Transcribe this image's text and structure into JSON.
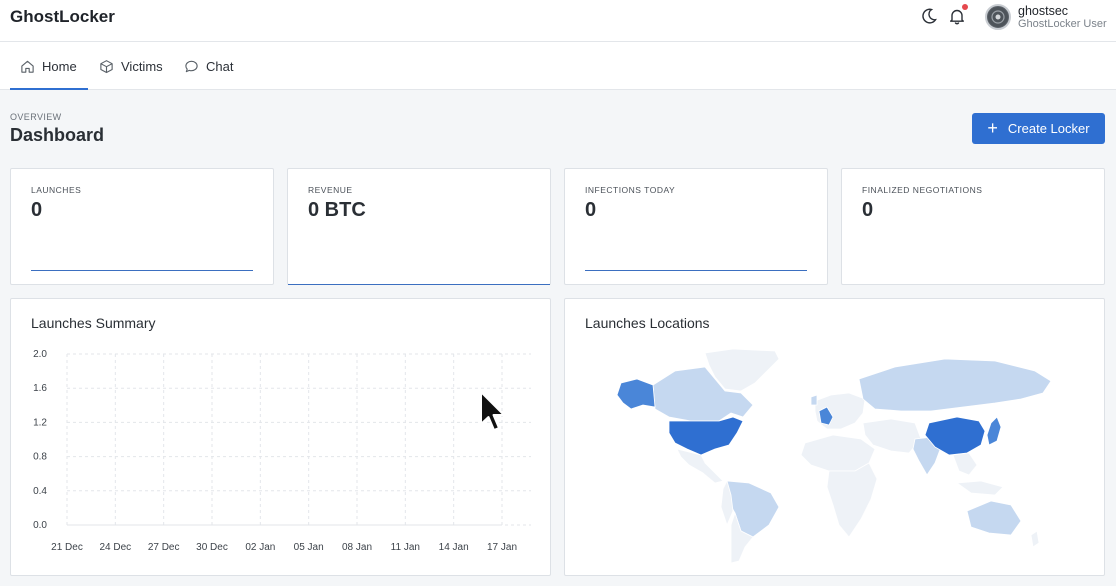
{
  "app": {
    "title": "GhostLocker"
  },
  "header": {
    "theme_icon": "moon-icon",
    "notification_icon": "bell-icon",
    "user": {
      "name": "ghostsec",
      "role": "GhostLocker User"
    }
  },
  "tabs": [
    {
      "label": "Home",
      "icon": "home-icon",
      "active": true
    },
    {
      "label": "Victims",
      "icon": "cube-icon",
      "active": false
    },
    {
      "label": "Chat",
      "icon": "chat-icon",
      "active": false
    }
  ],
  "page": {
    "overline": "OVERVIEW",
    "title": "Dashboard",
    "create_button": "Create Locker"
  },
  "stats": [
    {
      "label": "LAUNCHES",
      "value": "0"
    },
    {
      "label": "REVENUE",
      "value": "0 BTC"
    },
    {
      "label": "INFECTIONS TODAY",
      "value": "0"
    },
    {
      "label": "FINALIZED NEGOTIATIONS",
      "value": "0"
    }
  ],
  "launches_summary": {
    "title": "Launches Summary"
  },
  "launches_locations": {
    "title": "Launches Locations"
  },
  "colors": {
    "accent": "#2f6fd1",
    "map_dark": "#2f6fd1",
    "map_mid": "#4a86d8",
    "map_light": "#c5d8f0",
    "map_pale": "#eef2f7"
  },
  "chart_data": {
    "type": "line",
    "x": [
      "21 Dec",
      "24 Dec",
      "27 Dec",
      "30 Dec",
      "02 Jan",
      "05 Jan",
      "08 Jan",
      "11 Jan",
      "14 Jan",
      "17 Jan"
    ],
    "y_ticks": [
      "2.0",
      "1.6",
      "1.2",
      "0.8",
      "0.4",
      "0.0"
    ],
    "ylim": [
      0,
      2
    ],
    "series": [
      {
        "values": [
          0,
          0,
          0,
          0,
          0,
          0,
          0,
          0,
          0,
          0
        ]
      }
    ],
    "grid": true
  }
}
